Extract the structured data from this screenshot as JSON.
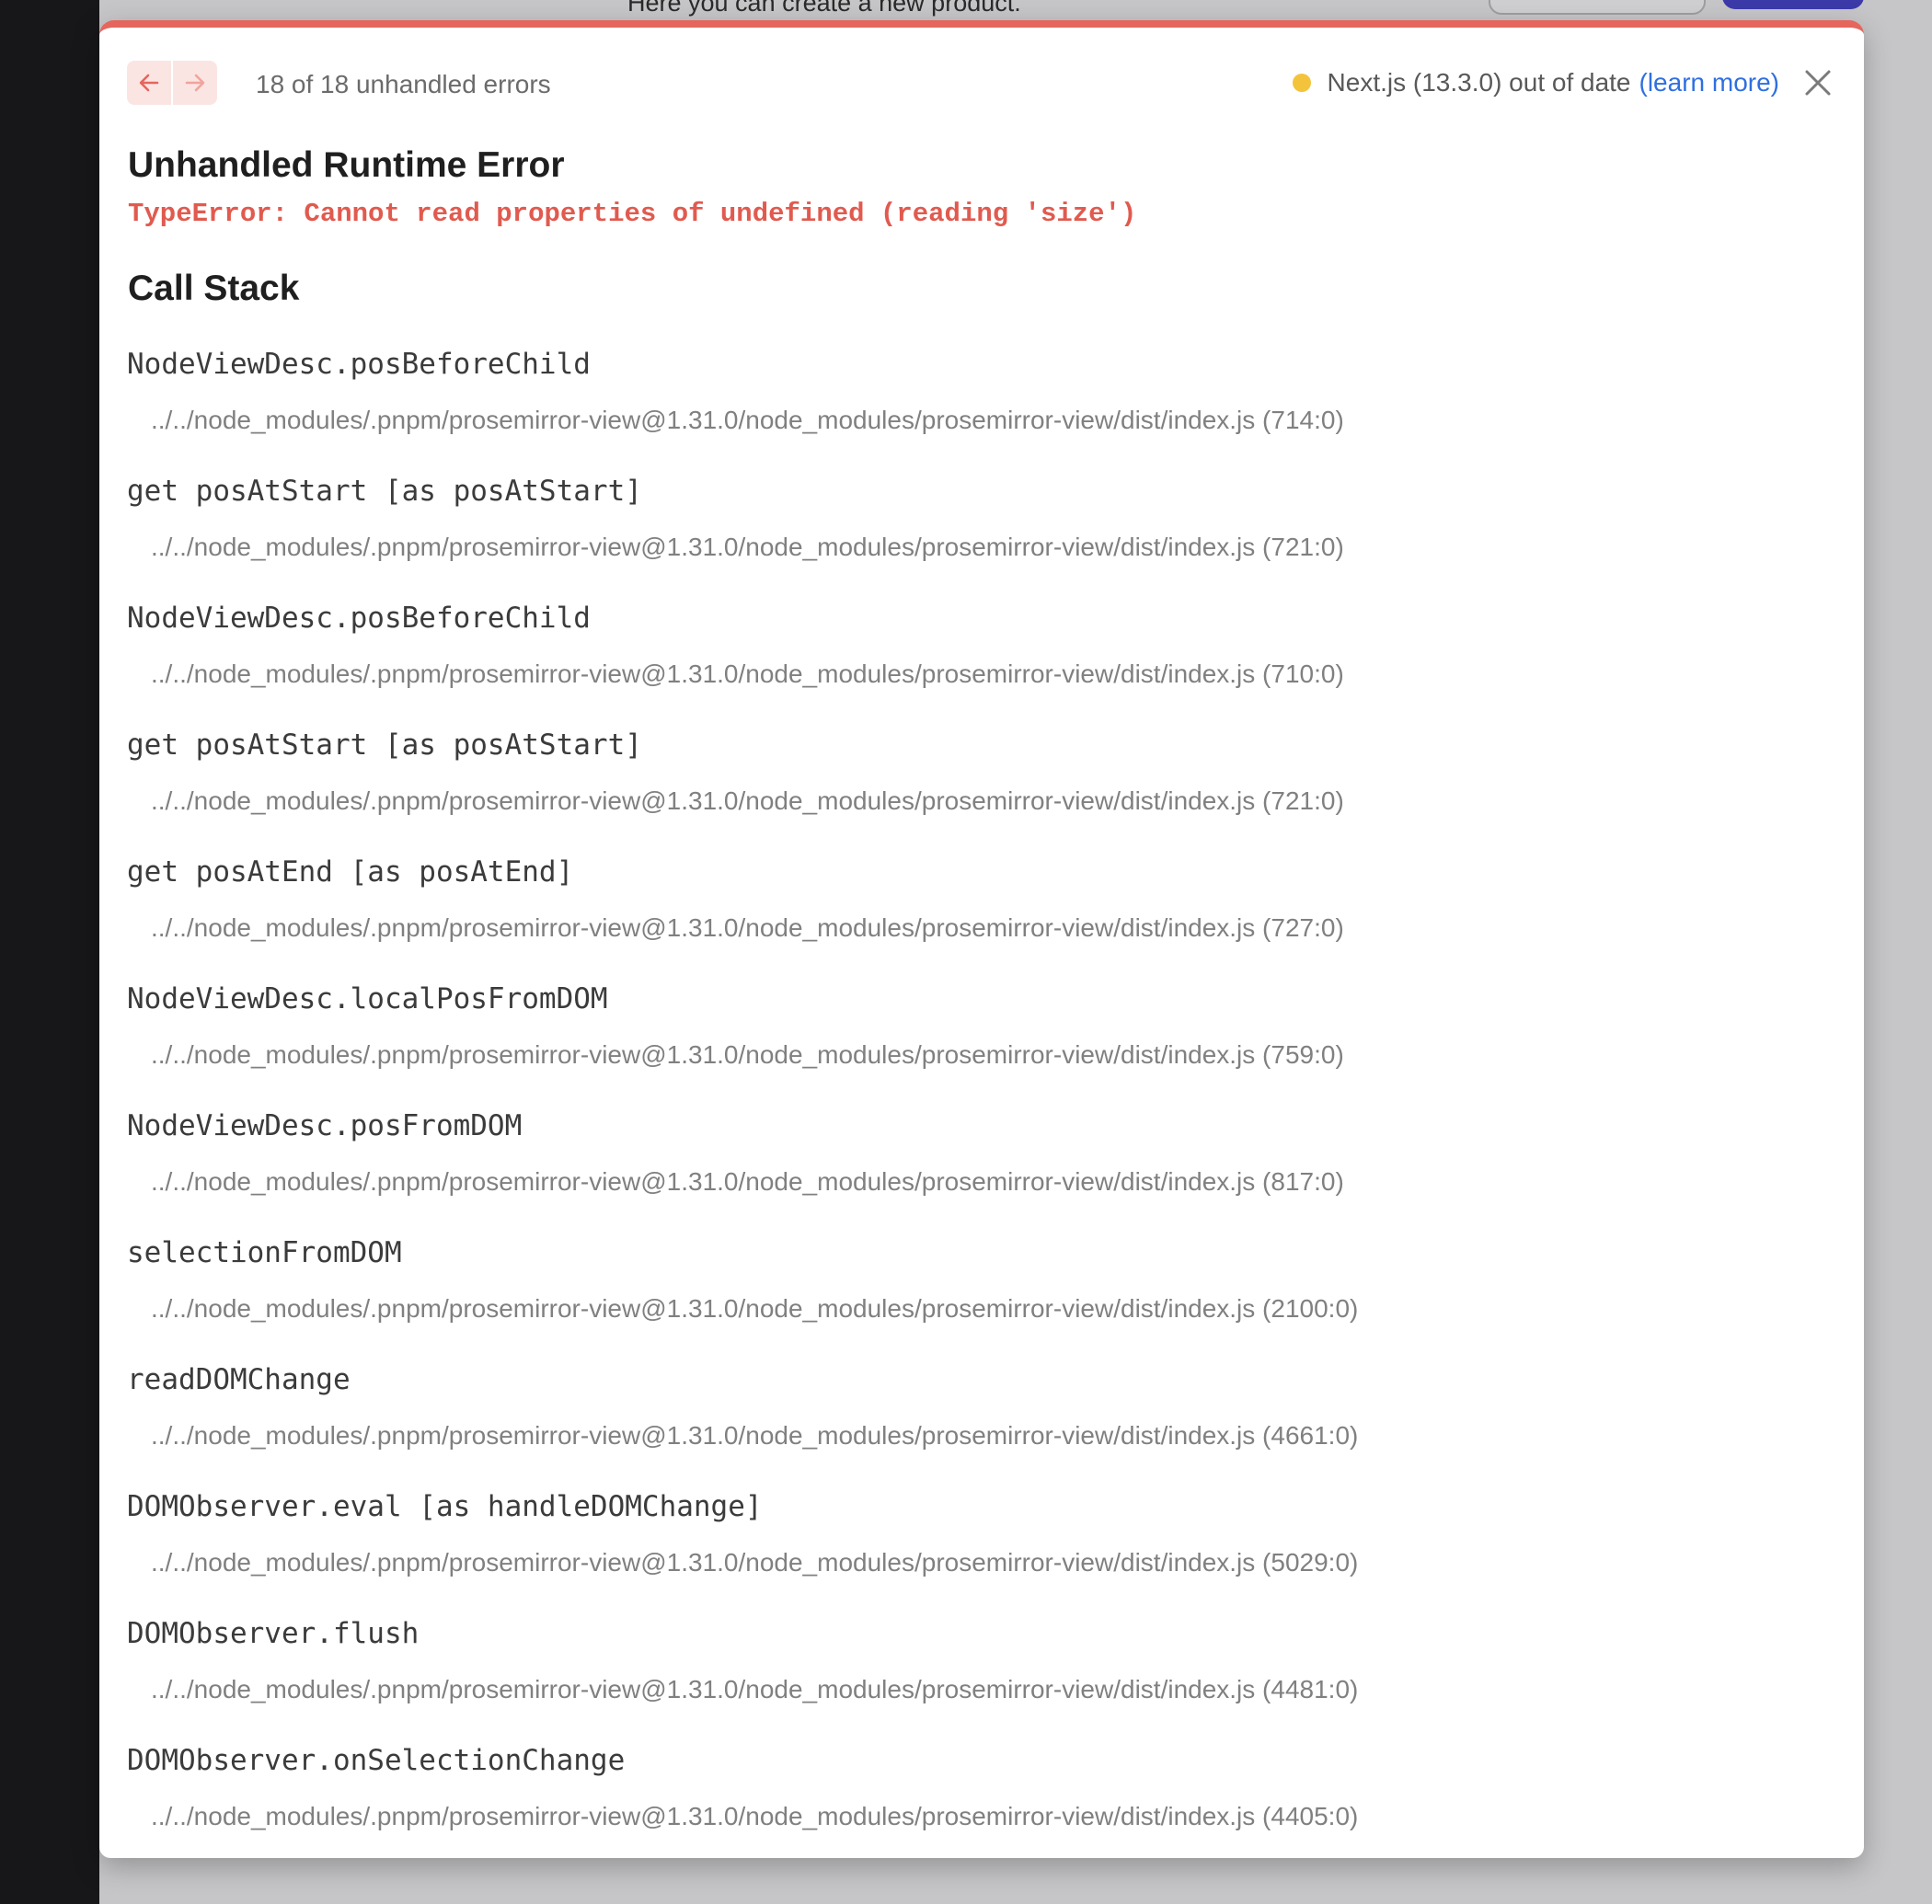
{
  "background": {
    "partial_text": "Here you can create a new product."
  },
  "overlay": {
    "accent_color": "#e5665d",
    "nav": {
      "prev_icon": "arrow-left-icon",
      "next_icon": "arrow-right-icon",
      "counter_text": "18 of 18 unhandled errors"
    },
    "version": {
      "status_color": "#f3c43b",
      "text": "Next.js (13.3.0) out of date",
      "learn_more": "(learn more)",
      "close_icon": "close-icon"
    },
    "error": {
      "title": "Unhandled Runtime Error",
      "message": "TypeError: Cannot read properties of undefined (reading 'size')"
    },
    "call_stack": {
      "title": "Call Stack",
      "frames": [
        {
          "fn": "NodeViewDesc.posBeforeChild",
          "loc": "../../node_modules/.pnpm/prosemirror-view@1.31.0/node_modules/prosemirror-view/dist/index.js (714:0)"
        },
        {
          "fn": "get posAtStart [as posAtStart]",
          "loc": "../../node_modules/.pnpm/prosemirror-view@1.31.0/node_modules/prosemirror-view/dist/index.js (721:0)"
        },
        {
          "fn": "NodeViewDesc.posBeforeChild",
          "loc": "../../node_modules/.pnpm/prosemirror-view@1.31.0/node_modules/prosemirror-view/dist/index.js (710:0)"
        },
        {
          "fn": "get posAtStart [as posAtStart]",
          "loc": "../../node_modules/.pnpm/prosemirror-view@1.31.0/node_modules/prosemirror-view/dist/index.js (721:0)"
        },
        {
          "fn": "get posAtEnd [as posAtEnd]",
          "loc": "../../node_modules/.pnpm/prosemirror-view@1.31.0/node_modules/prosemirror-view/dist/index.js (727:0)"
        },
        {
          "fn": "NodeViewDesc.localPosFromDOM",
          "loc": "../../node_modules/.pnpm/prosemirror-view@1.31.0/node_modules/prosemirror-view/dist/index.js (759:0)"
        },
        {
          "fn": "NodeViewDesc.posFromDOM",
          "loc": "../../node_modules/.pnpm/prosemirror-view@1.31.0/node_modules/prosemirror-view/dist/index.js (817:0)"
        },
        {
          "fn": "selectionFromDOM",
          "loc": "../../node_modules/.pnpm/prosemirror-view@1.31.0/node_modules/prosemirror-view/dist/index.js (2100:0)"
        },
        {
          "fn": "readDOMChange",
          "loc": "../../node_modules/.pnpm/prosemirror-view@1.31.0/node_modules/prosemirror-view/dist/index.js (4661:0)"
        },
        {
          "fn": "DOMObserver.eval [as handleDOMChange]",
          "loc": "../../node_modules/.pnpm/prosemirror-view@1.31.0/node_modules/prosemirror-view/dist/index.js (5029:0)"
        },
        {
          "fn": "DOMObserver.flush",
          "loc": "../../node_modules/.pnpm/prosemirror-view@1.31.0/node_modules/prosemirror-view/dist/index.js (4481:0)"
        },
        {
          "fn": "DOMObserver.onSelectionChange",
          "loc": "../../node_modules/.pnpm/prosemirror-view@1.31.0/node_modules/prosemirror-view/dist/index.js (4405:0)"
        }
      ]
    }
  }
}
